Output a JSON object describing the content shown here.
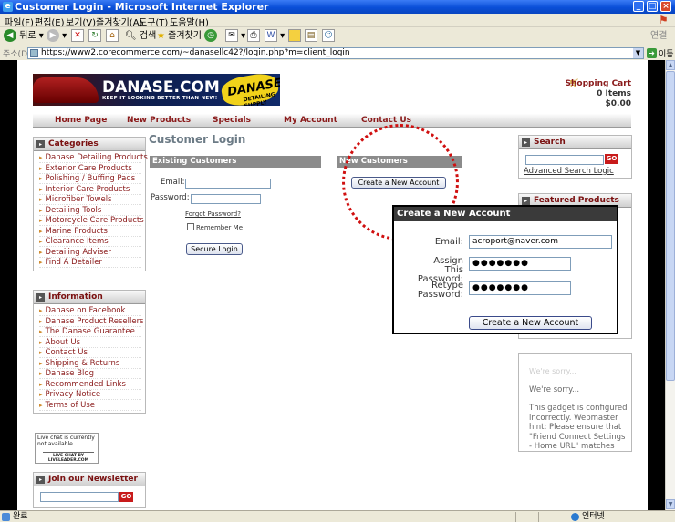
{
  "window": {
    "title": "Customer Login - Microsoft Internet Explorer",
    "buttons": [
      "_",
      "□",
      "×"
    ]
  },
  "menu": [
    "파일(F)",
    "편집(E)",
    "보기(V)",
    "즐겨찾기(A)",
    "도구(T)",
    "도움말(H)"
  ],
  "toolbar": {
    "back": "뒤로",
    "search": "검색",
    "favorites": "즐겨찾기",
    "links": "연결"
  },
  "address": {
    "label": "주소(D)",
    "url": "https://www2.corecommerce.com/~danasellc42?/login.php?m=client_login",
    "go": "이동"
  },
  "site": {
    "logo_name": "DANASE.COM",
    "logo_tagline": "KEEP IT LOOKING BETTER THAN NEW!",
    "logo_badge": "DANASE",
    "logo_badge_sub": "DETAILING SUPPLY",
    "cart_link": "Shopping Cart",
    "cart_items": "0 Items",
    "cart_total": "$0.00"
  },
  "nav": [
    "Home Page",
    "New Products",
    "Specials",
    "My Account",
    "Contact Us"
  ],
  "categories": {
    "title": "Categories",
    "items": [
      "Danase Detailing Products",
      "Exterior Care Products",
      "Polishing / Buffing Pads",
      "Interior Care Products",
      "Microfiber Towels",
      "Detailing Tools",
      "Motorcycle Care Products",
      "Marine Products",
      "Clearance Items",
      "Detailing Adviser",
      "Find A Detailer"
    ]
  },
  "information": {
    "title": "Information",
    "items": [
      "Danase on Facebook",
      "Danase Product Resellers",
      "The Danase Guarantee",
      "About Us",
      "Contact Us",
      "Shipping & Returns",
      "Danase Blog",
      "Recommended Links",
      "Privacy Notice",
      "Terms of Use"
    ]
  },
  "livechat": {
    "line1": "Live chat is currently",
    "line2": "not available",
    "badge": "LIVE CHAT BY LIVELEADER.COM"
  },
  "newsletter": {
    "title": "Join our Newsletter",
    "go": "GO"
  },
  "login": {
    "page_title": "Customer Login",
    "existing_title": "Existing Customers",
    "email_label": "Email:",
    "password_label": "Password:",
    "forgot": "Forgot Password?",
    "remember": "Remember Me",
    "submit": "Secure Login",
    "new_title": "New Customers",
    "create_button": "Create a New Account"
  },
  "search": {
    "title": "Search",
    "go": "GO",
    "advanced": "Advanced Search Logic"
  },
  "featured": {
    "title": "Featured Products"
  },
  "gadget": {
    "faint": "We're sorry...",
    "sorry": "We're sorry...",
    "message": "This gadget is configured incorrectly. Webmaster hint: Please ensure that \"Friend Connect Settings - Home URL\" matches the URL of this site."
  },
  "popup": {
    "title": "Create a New Account",
    "email_label": "Email:",
    "email_value": "acroport@naver.com",
    "password_label": "Assign This Password:",
    "password_value": "●●●●●●●",
    "retype_label": "Retype Password:",
    "retype_value": "●●●●●●●",
    "submit": "Create a New Account"
  },
  "status": {
    "text": "완료",
    "zone": "인터넷"
  }
}
